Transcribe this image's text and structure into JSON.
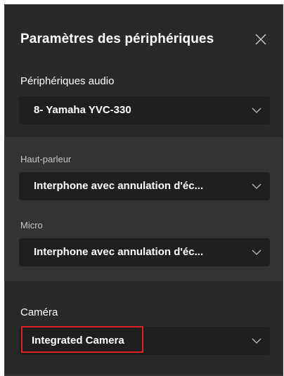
{
  "dialog": {
    "title": "Paramètres des périphériques",
    "close_icon": "close-icon"
  },
  "audio_devices": {
    "label": "Périphériques audio",
    "selected": "8- Yamaha YVC-330"
  },
  "speaker": {
    "label": "Haut-parleur",
    "selected": "Interphone avec annulation d'éc..."
  },
  "microphone": {
    "label": "Micro",
    "selected": "Interphone avec annulation d'éc..."
  },
  "camera": {
    "label": "Caméra",
    "selected": "Integrated Camera"
  },
  "colors": {
    "panel_bg": "#292929",
    "dropdown_bg": "#1f1f1f",
    "sub_section_bg": "#333333",
    "highlight_border": "#e01f26"
  }
}
